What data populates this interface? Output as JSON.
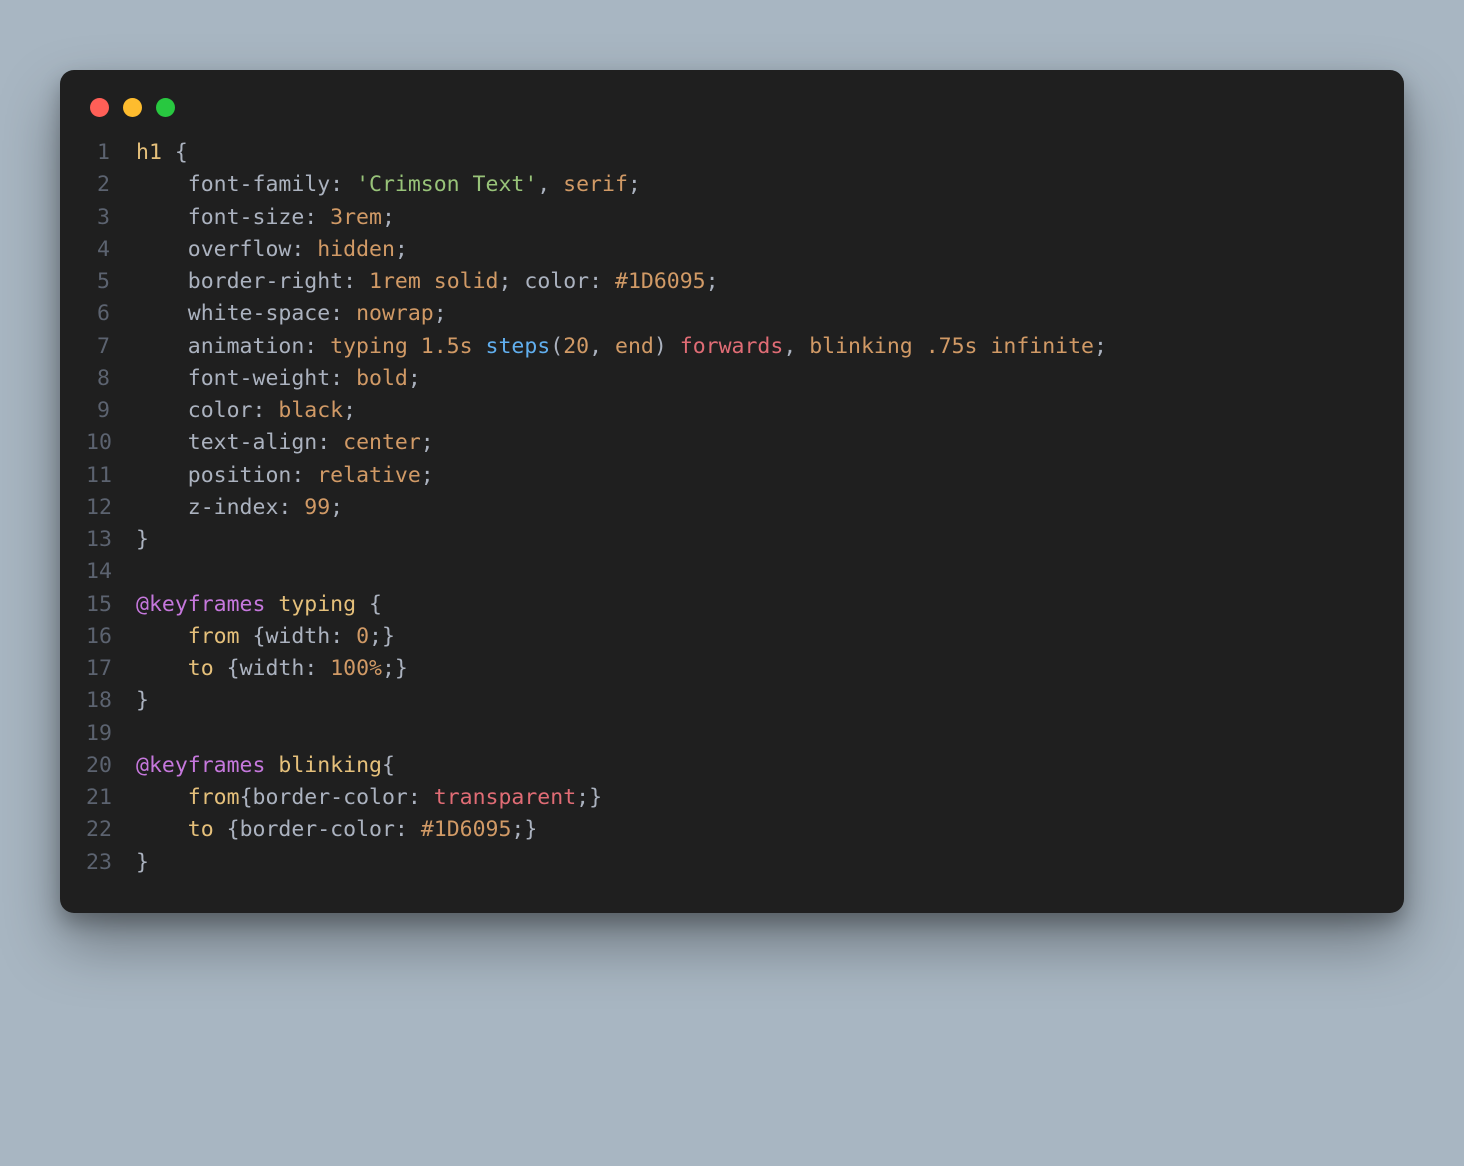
{
  "window": {
    "traffic_lights": [
      "red",
      "yellow",
      "green"
    ]
  },
  "colors": {
    "background_page": "#a8b6c2",
    "background_window": "#1f1f1f",
    "gutter": "#5c6370",
    "text": "#abb2bf",
    "selector": "#e5c07b",
    "string": "#98c379",
    "value": "#d19a66",
    "function": "#61afef",
    "keyword": "#c678dd",
    "name": "#e06c75"
  },
  "code": {
    "language": "css",
    "lines": [
      {
        "n": "1",
        "tokens": [
          [
            "sel",
            "h1"
          ],
          [
            "plain",
            " "
          ],
          [
            "punc",
            "{"
          ]
        ]
      },
      {
        "n": "2",
        "tokens": [
          [
            "plain",
            "    "
          ],
          [
            "prop",
            "font-family"
          ],
          [
            "punc",
            ": "
          ],
          [
            "str",
            "'Crimson Text'"
          ],
          [
            "punc",
            ", "
          ],
          [
            "val",
            "serif"
          ],
          [
            "punc",
            ";"
          ]
        ]
      },
      {
        "n": "3",
        "tokens": [
          [
            "plain",
            "    "
          ],
          [
            "prop",
            "font-size"
          ],
          [
            "punc",
            ": "
          ],
          [
            "val",
            "3rem"
          ],
          [
            "punc",
            ";"
          ]
        ]
      },
      {
        "n": "4",
        "tokens": [
          [
            "plain",
            "    "
          ],
          [
            "prop",
            "overflow"
          ],
          [
            "punc",
            ": "
          ],
          [
            "val",
            "hidden"
          ],
          [
            "punc",
            ";"
          ]
        ]
      },
      {
        "n": "5",
        "tokens": [
          [
            "plain",
            "    "
          ],
          [
            "prop",
            "border-right"
          ],
          [
            "punc",
            ": "
          ],
          [
            "val",
            "1rem"
          ],
          [
            "plain",
            " "
          ],
          [
            "val",
            "solid"
          ],
          [
            "punc",
            "; "
          ],
          [
            "prop",
            "color"
          ],
          [
            "punc",
            ": "
          ],
          [
            "val",
            "#1D6095"
          ],
          [
            "punc",
            ";"
          ]
        ]
      },
      {
        "n": "6",
        "tokens": [
          [
            "plain",
            "    "
          ],
          [
            "prop",
            "white-space"
          ],
          [
            "punc",
            ": "
          ],
          [
            "val",
            "nowrap"
          ],
          [
            "punc",
            ";"
          ]
        ]
      },
      {
        "n": "7",
        "tokens": [
          [
            "plain",
            "    "
          ],
          [
            "prop",
            "animation"
          ],
          [
            "punc",
            ": "
          ],
          [
            "val",
            "typing"
          ],
          [
            "plain",
            " "
          ],
          [
            "val",
            "1.5s"
          ],
          [
            "plain",
            " "
          ],
          [
            "fn",
            "steps"
          ],
          [
            "punc",
            "("
          ],
          [
            "val",
            "20"
          ],
          [
            "punc",
            ", "
          ],
          [
            "val",
            "end"
          ],
          [
            "punc",
            ")"
          ],
          [
            "plain",
            " "
          ],
          [
            "name",
            "forwards"
          ],
          [
            "punc",
            ", "
          ],
          [
            "val",
            "blinking"
          ],
          [
            "plain",
            " "
          ],
          [
            "val",
            ".75s"
          ],
          [
            "plain",
            " "
          ],
          [
            "val",
            "infinite"
          ],
          [
            "punc",
            ";"
          ]
        ]
      },
      {
        "n": "8",
        "tokens": [
          [
            "plain",
            "    "
          ],
          [
            "prop",
            "font-weight"
          ],
          [
            "punc",
            ": "
          ],
          [
            "val",
            "bold"
          ],
          [
            "punc",
            ";"
          ]
        ]
      },
      {
        "n": "9",
        "tokens": [
          [
            "plain",
            "    "
          ],
          [
            "prop",
            "color"
          ],
          [
            "punc",
            ": "
          ],
          [
            "val",
            "black"
          ],
          [
            "punc",
            ";"
          ]
        ]
      },
      {
        "n": "10",
        "tokens": [
          [
            "plain",
            "    "
          ],
          [
            "prop",
            "text-align"
          ],
          [
            "punc",
            ": "
          ],
          [
            "val",
            "center"
          ],
          [
            "punc",
            ";"
          ]
        ]
      },
      {
        "n": "11",
        "tokens": [
          [
            "plain",
            "    "
          ],
          [
            "prop",
            "position"
          ],
          [
            "punc",
            ": "
          ],
          [
            "val",
            "relative"
          ],
          [
            "punc",
            ";"
          ]
        ]
      },
      {
        "n": "12",
        "tokens": [
          [
            "plain",
            "    "
          ],
          [
            "prop",
            "z-index"
          ],
          [
            "punc",
            ": "
          ],
          [
            "val",
            "99"
          ],
          [
            "punc",
            ";"
          ]
        ]
      },
      {
        "n": "13",
        "tokens": [
          [
            "punc",
            "}"
          ]
        ]
      },
      {
        "n": "14",
        "tokens": [
          [
            "plain",
            ""
          ]
        ]
      },
      {
        "n": "15",
        "tokens": [
          [
            "kw",
            "@keyframes"
          ],
          [
            "plain",
            " "
          ],
          [
            "sel",
            "typing"
          ],
          [
            "plain",
            " "
          ],
          [
            "punc",
            "{"
          ]
        ]
      },
      {
        "n": "16",
        "tokens": [
          [
            "plain",
            "    "
          ],
          [
            "sel",
            "from"
          ],
          [
            "plain",
            " "
          ],
          [
            "punc",
            "{"
          ],
          [
            "prop",
            "width"
          ],
          [
            "punc",
            ": "
          ],
          [
            "val",
            "0"
          ],
          [
            "punc",
            ";}"
          ]
        ]
      },
      {
        "n": "17",
        "tokens": [
          [
            "plain",
            "    "
          ],
          [
            "sel",
            "to"
          ],
          [
            "plain",
            " "
          ],
          [
            "punc",
            "{"
          ],
          [
            "prop",
            "width"
          ],
          [
            "punc",
            ": "
          ],
          [
            "val",
            "100%"
          ],
          [
            "punc",
            ";}"
          ]
        ]
      },
      {
        "n": "18",
        "tokens": [
          [
            "punc",
            "}"
          ]
        ]
      },
      {
        "n": "19",
        "tokens": [
          [
            "plain",
            ""
          ]
        ]
      },
      {
        "n": "20",
        "tokens": [
          [
            "kw",
            "@keyframes"
          ],
          [
            "plain",
            " "
          ],
          [
            "sel",
            "blinking"
          ],
          [
            "punc",
            "{"
          ]
        ]
      },
      {
        "n": "21",
        "tokens": [
          [
            "plain",
            "    "
          ],
          [
            "sel",
            "from"
          ],
          [
            "punc",
            "{"
          ],
          [
            "prop",
            "border-color"
          ],
          [
            "punc",
            ": "
          ],
          [
            "name",
            "transparent"
          ],
          [
            "punc",
            ";}"
          ]
        ]
      },
      {
        "n": "22",
        "tokens": [
          [
            "plain",
            "    "
          ],
          [
            "sel",
            "to"
          ],
          [
            "plain",
            " "
          ],
          [
            "punc",
            "{"
          ],
          [
            "prop",
            "border-color"
          ],
          [
            "punc",
            ": "
          ],
          [
            "val",
            "#1D6095"
          ],
          [
            "punc",
            ";}"
          ]
        ]
      },
      {
        "n": "23",
        "tokens": [
          [
            "punc",
            "}"
          ]
        ]
      }
    ]
  }
}
